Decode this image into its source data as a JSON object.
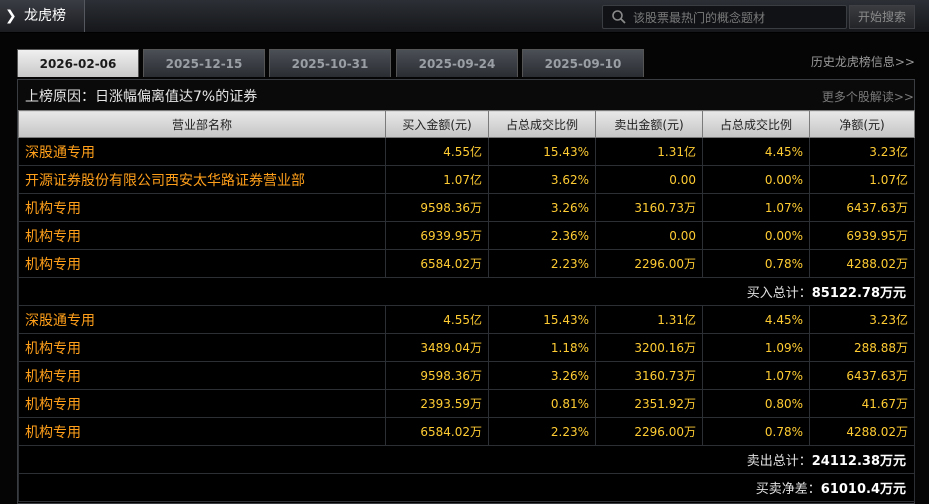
{
  "header": {
    "title": "龙虎榜",
    "search_placeholder": "该股票最热门的概念题材",
    "search_button": "开始搜索"
  },
  "tabs": [
    {
      "label": "2026-02-06",
      "active": true
    },
    {
      "label": "2025-12-15",
      "active": false
    },
    {
      "label": "2025-10-31",
      "active": false
    },
    {
      "label": "2025-09-24",
      "active": false
    },
    {
      "label": "2025-09-10",
      "active": false
    }
  ],
  "history_link": "历史龙虎榜信息>>",
  "reason": {
    "text": "上榜原因：日涨幅偏离值达7%的证券",
    "more_link": "更多个股解读>>"
  },
  "table": {
    "headers": [
      "营业部名称",
      "买入金额(元)",
      "占总成交比例",
      "卖出金额(元)",
      "占总成交比例",
      "净额(元)"
    ],
    "buy_rows": [
      [
        "深股通专用",
        "4.55亿",
        "15.43%",
        "1.31亿",
        "4.45%",
        "3.23亿"
      ],
      [
        "开源证券股份有限公司西安太华路证券营业部",
        "1.07亿",
        "3.62%",
        "0.00",
        "0.00%",
        "1.07亿"
      ],
      [
        "机构专用",
        "9598.36万",
        "3.26%",
        "3160.73万",
        "1.07%",
        "6437.63万"
      ],
      [
        "机构专用",
        "6939.95万",
        "2.36%",
        "0.00",
        "0.00%",
        "6939.95万"
      ],
      [
        "机构专用",
        "6584.02万",
        "2.23%",
        "2296.00万",
        "0.78%",
        "4288.02万"
      ]
    ],
    "buy_total": {
      "label": "买入总计：",
      "value": "85122.78万元"
    },
    "sell_rows": [
      [
        "深股通专用",
        "4.55亿",
        "15.43%",
        "1.31亿",
        "4.45%",
        "3.23亿"
      ],
      [
        "机构专用",
        "3489.04万",
        "1.18%",
        "3200.16万",
        "1.09%",
        "288.88万"
      ],
      [
        "机构专用",
        "9598.36万",
        "3.26%",
        "3160.73万",
        "1.07%",
        "6437.63万"
      ],
      [
        "机构专用",
        "2393.59万",
        "0.81%",
        "2351.92万",
        "0.80%",
        "41.67万"
      ],
      [
        "机构专用",
        "6584.02万",
        "2.23%",
        "2296.00万",
        "0.78%",
        "4288.02万"
      ]
    ],
    "sell_total": {
      "label": "卖出总计：",
      "value": "24112.38万元"
    },
    "net_total": {
      "label": "买卖净差：",
      "value": "61010.4万元"
    }
  }
}
